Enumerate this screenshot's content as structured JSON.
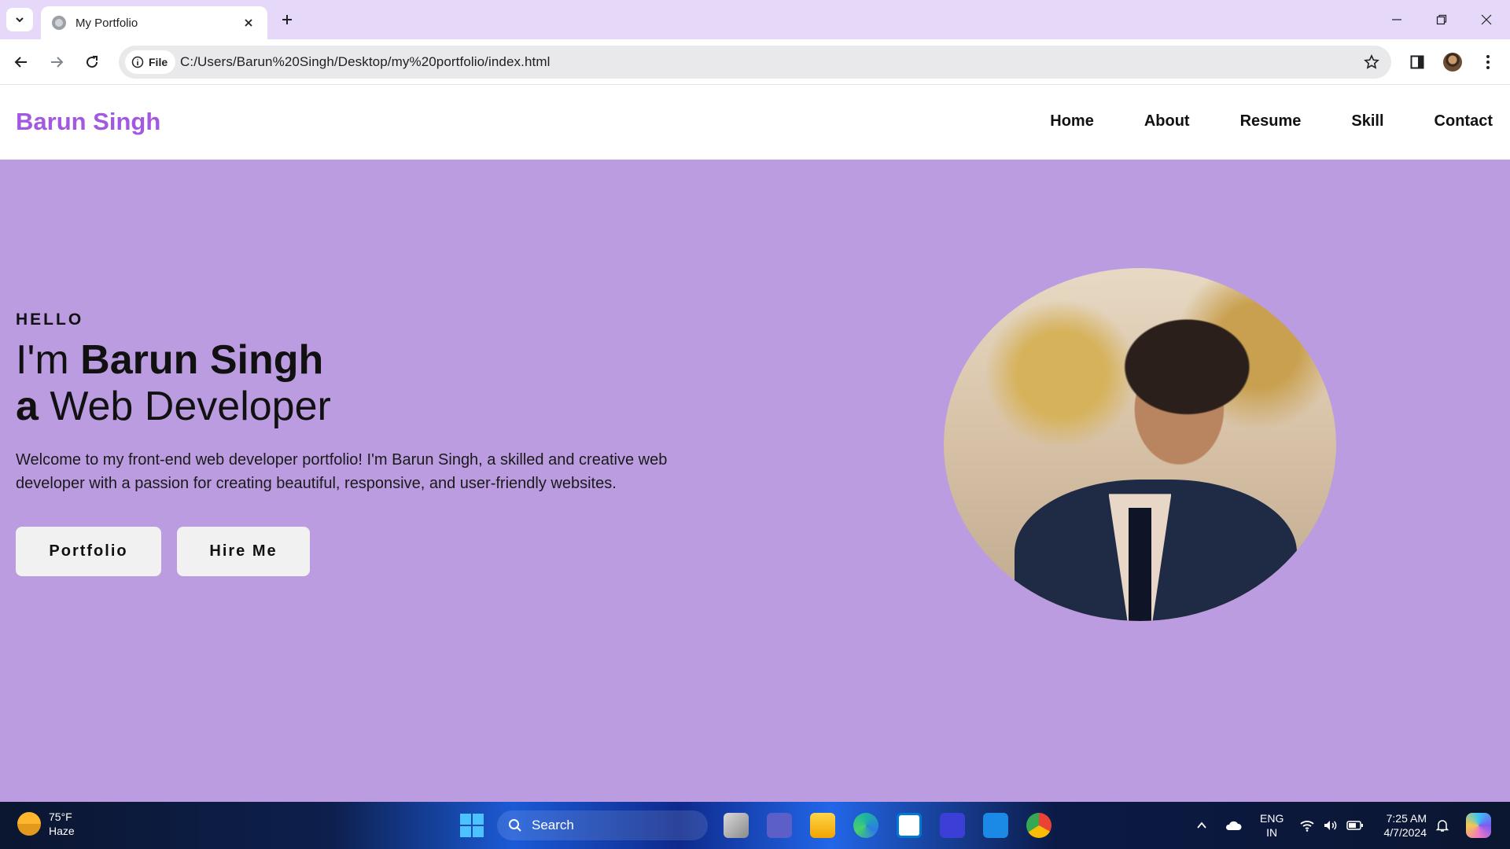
{
  "browser": {
    "tab_title": "My Portfolio",
    "omnibox_chip": "File",
    "url": "C:/Users/Barun%20Singh/Desktop/my%20portfolio/index.html"
  },
  "site": {
    "brand": "Barun Singh",
    "nav": [
      "Home",
      "About",
      "Resume",
      "Skill",
      "Contact"
    ]
  },
  "hero": {
    "greeting": "HELLO",
    "line1_prefix": "I'm ",
    "line1_name": "Barun Singh",
    "line2_prefix": "a",
    "line2_role": " Web Developer",
    "description": "Welcome to my front-end web developer portfolio! I'm Barun Singh, a skilled and creative web developer with a passion for creating beautiful, responsive, and user-friendly websites.",
    "buttons": {
      "portfolio": "Portfolio",
      "hire": "Hire Me"
    }
  },
  "taskbar": {
    "weather_temp": "75°F",
    "weather_cond": "Haze",
    "search_label": "Search",
    "lang_line1": "ENG",
    "lang_line2": "IN",
    "time": "7:25 AM",
    "date": "4/7/2024"
  },
  "colors": {
    "brand": "#a259e0",
    "hero_bg": "#bc9ce1",
    "tabbar_bg": "#e6d8f9"
  },
  "icons": [
    "tab-search-icon",
    "globe-icon",
    "close-icon",
    "plus-icon",
    "minimize-icon",
    "restore-icon",
    "back-icon",
    "forward-icon",
    "reload-icon",
    "info-icon",
    "star-icon",
    "sidepanel-icon",
    "menu-icon",
    "windows-start-icon",
    "search-icon",
    "chevron-up-icon",
    "cloud-icon",
    "wifi-icon",
    "volume-icon",
    "battery-icon",
    "bell-icon"
  ]
}
